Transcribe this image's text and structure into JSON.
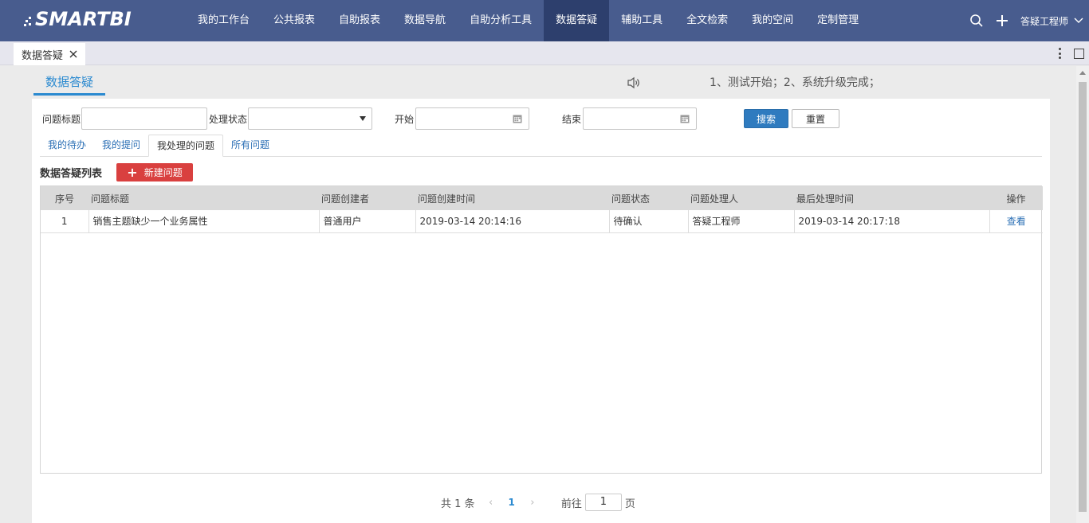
{
  "logo": {
    "text": "SMARTBI"
  },
  "nav": {
    "items": [
      {
        "label": "我的工作台",
        "active": false
      },
      {
        "label": "公共报表",
        "active": false
      },
      {
        "label": "自助报表",
        "active": false
      },
      {
        "label": "数据导航",
        "active": false
      },
      {
        "label": "自助分析工具",
        "active": false
      },
      {
        "label": "数据答疑",
        "active": true
      },
      {
        "label": "辅助工具",
        "active": false
      },
      {
        "label": "全文检索",
        "active": false
      },
      {
        "label": "我的空间",
        "active": false
      },
      {
        "label": "定制管理",
        "active": false
      }
    ],
    "user": "答疑工程师"
  },
  "tabstrip": {
    "tab_label": "数据答疑"
  },
  "header": {
    "title": "数据答疑",
    "notice": "1、测试开始；2、系统升级完成；"
  },
  "form": {
    "title_label": "问题标题",
    "title_value": "",
    "status_label": "处理状态",
    "status_value": "",
    "start_label": "开始",
    "start_value": "",
    "end_label": "结束",
    "end_value": "",
    "search_button": "搜索",
    "reset_button": "重置"
  },
  "subtabs": [
    {
      "label": "我的待办",
      "active": false
    },
    {
      "label": "我的提问",
      "active": false
    },
    {
      "label": "我处理的问题",
      "active": true
    },
    {
      "label": "所有问题",
      "active": false
    }
  ],
  "list": {
    "title": "数据答疑列表",
    "new_button": "新建问题",
    "columns": [
      "序号",
      "问题标题",
      "问题创建者",
      "问题创建时间",
      "问题状态",
      "问题处理人",
      "最后处理时间",
      "操作"
    ],
    "rows": [
      {
        "index": "1",
        "title": "销售主题缺少一个业务属性",
        "creator": "普通用户",
        "created": "2019-03-14 20:14:16",
        "status": "待确认",
        "handler": "答疑工程师",
        "last": "2019-03-14 20:17:18",
        "action": "查看"
      }
    ]
  },
  "pager": {
    "total_text": "共 1 条",
    "current_page": "1",
    "goto_prefix": "前往",
    "goto_value": "1",
    "goto_suffix": "页"
  },
  "colors": {
    "topbar": "#485c8e",
    "nav_active": "#2d3f6d",
    "accent": "#2b8ad0",
    "search_button": "#2f7bbf",
    "new_button": "#d9403f"
  }
}
